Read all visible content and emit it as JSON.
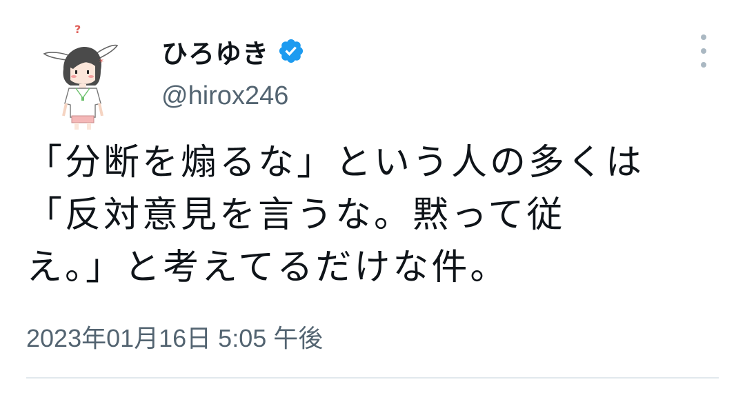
{
  "tweet": {
    "display_name": "ひろゆき",
    "handle": "@hirox246",
    "verified": true,
    "body_lines": [
      "「分断を煽るな」という人の多くは",
      "「反対意見を言うな。黙って従",
      "え。」と考えてるだけな件。"
    ],
    "timestamp": "2023年01月16日 5:05 午後",
    "avatar_marks": {
      "question": "?",
      "blush": "*"
    }
  },
  "icons": {
    "verified": "verified-badge-icon",
    "more": "more-options-icon"
  },
  "colors": {
    "verified_blue": "#1d9bf0",
    "secondary_text": "#536471",
    "primary_text": "#0f1419",
    "divider": "#e1e8ed"
  }
}
